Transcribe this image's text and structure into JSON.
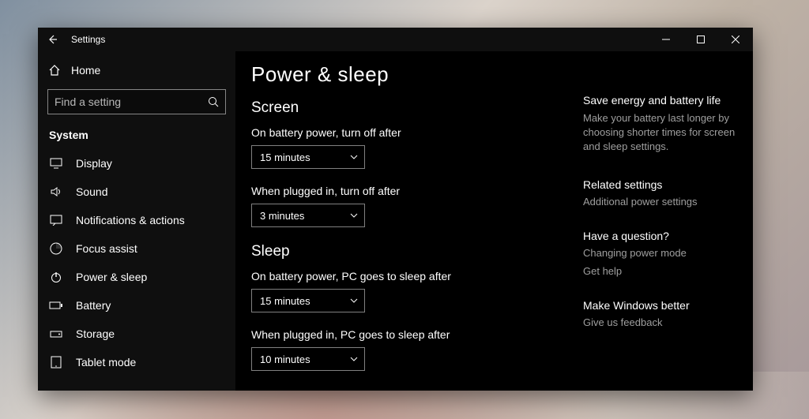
{
  "titlebar": {
    "title": "Settings"
  },
  "sidebar": {
    "home": "Home",
    "search_placeholder": "Find a setting",
    "section": "System",
    "items": [
      {
        "icon": "display",
        "label": "Display"
      },
      {
        "icon": "sound",
        "label": "Sound"
      },
      {
        "icon": "notifications",
        "label": "Notifications & actions"
      },
      {
        "icon": "focus",
        "label": "Focus assist"
      },
      {
        "icon": "power",
        "label": "Power & sleep"
      },
      {
        "icon": "battery",
        "label": "Battery"
      },
      {
        "icon": "storage",
        "label": "Storage"
      },
      {
        "icon": "tablet",
        "label": "Tablet mode"
      }
    ]
  },
  "page": {
    "title": "Power & sleep",
    "screen": {
      "heading": "Screen",
      "battery_label": "On battery power, turn off after",
      "battery_value": "15 minutes",
      "plugged_label": "When plugged in, turn off after",
      "plugged_value": "3 minutes"
    },
    "sleep": {
      "heading": "Sleep",
      "battery_label": "On battery power, PC goes to sleep after",
      "battery_value": "15 minutes",
      "plugged_label": "When plugged in, PC goes to sleep after",
      "plugged_value": "10 minutes"
    }
  },
  "aside": {
    "energy_head": "Save energy and battery life",
    "energy_text": "Make your battery last longer by choosing shorter times for screen and sleep settings.",
    "related_head": "Related settings",
    "related_link": "Additional power settings",
    "question_head": "Have a question?",
    "question_link1": "Changing power mode",
    "question_link2": "Get help",
    "better_head": "Make Windows better",
    "better_link": "Give us feedback"
  }
}
